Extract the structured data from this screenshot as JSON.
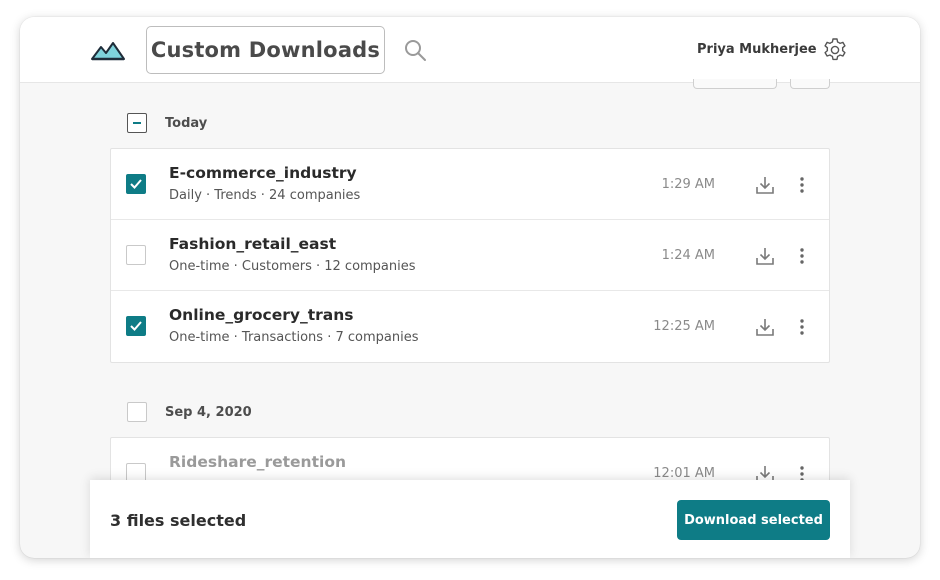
{
  "header": {
    "title": "Custom Downloads",
    "user_name": "Priya Mukherjee",
    "icons": {
      "logo": "mountain-logo",
      "search": "search-icon",
      "settings": "gear-icon"
    }
  },
  "groups": [
    {
      "label": "Today",
      "select_state": "indeterminate",
      "files": [
        {
          "name": "E-commerce_industry",
          "meta": "Daily · Trends · 24 companies",
          "time": "1:29 AM",
          "checked": true
        },
        {
          "name": "Fashion_retail_east",
          "meta": "One-time · Customers · 12 companies",
          "time": "1:24 AM",
          "checked": false
        },
        {
          "name": "Online_grocery_trans",
          "meta": "One-time · Transactions · 7 companies",
          "time": "12:25 AM",
          "checked": true
        }
      ]
    },
    {
      "label": "Sep 4, 2020",
      "select_state": "unchecked",
      "files": [
        {
          "name": "Rideshare_retention",
          "meta": "",
          "time": "12:01 AM",
          "checked": false
        }
      ]
    }
  ],
  "footer": {
    "selected_text": "3 files selected",
    "download_label": "Download selected"
  },
  "colors": {
    "accent": "#0e7c86",
    "error_text": "#d0303a"
  }
}
